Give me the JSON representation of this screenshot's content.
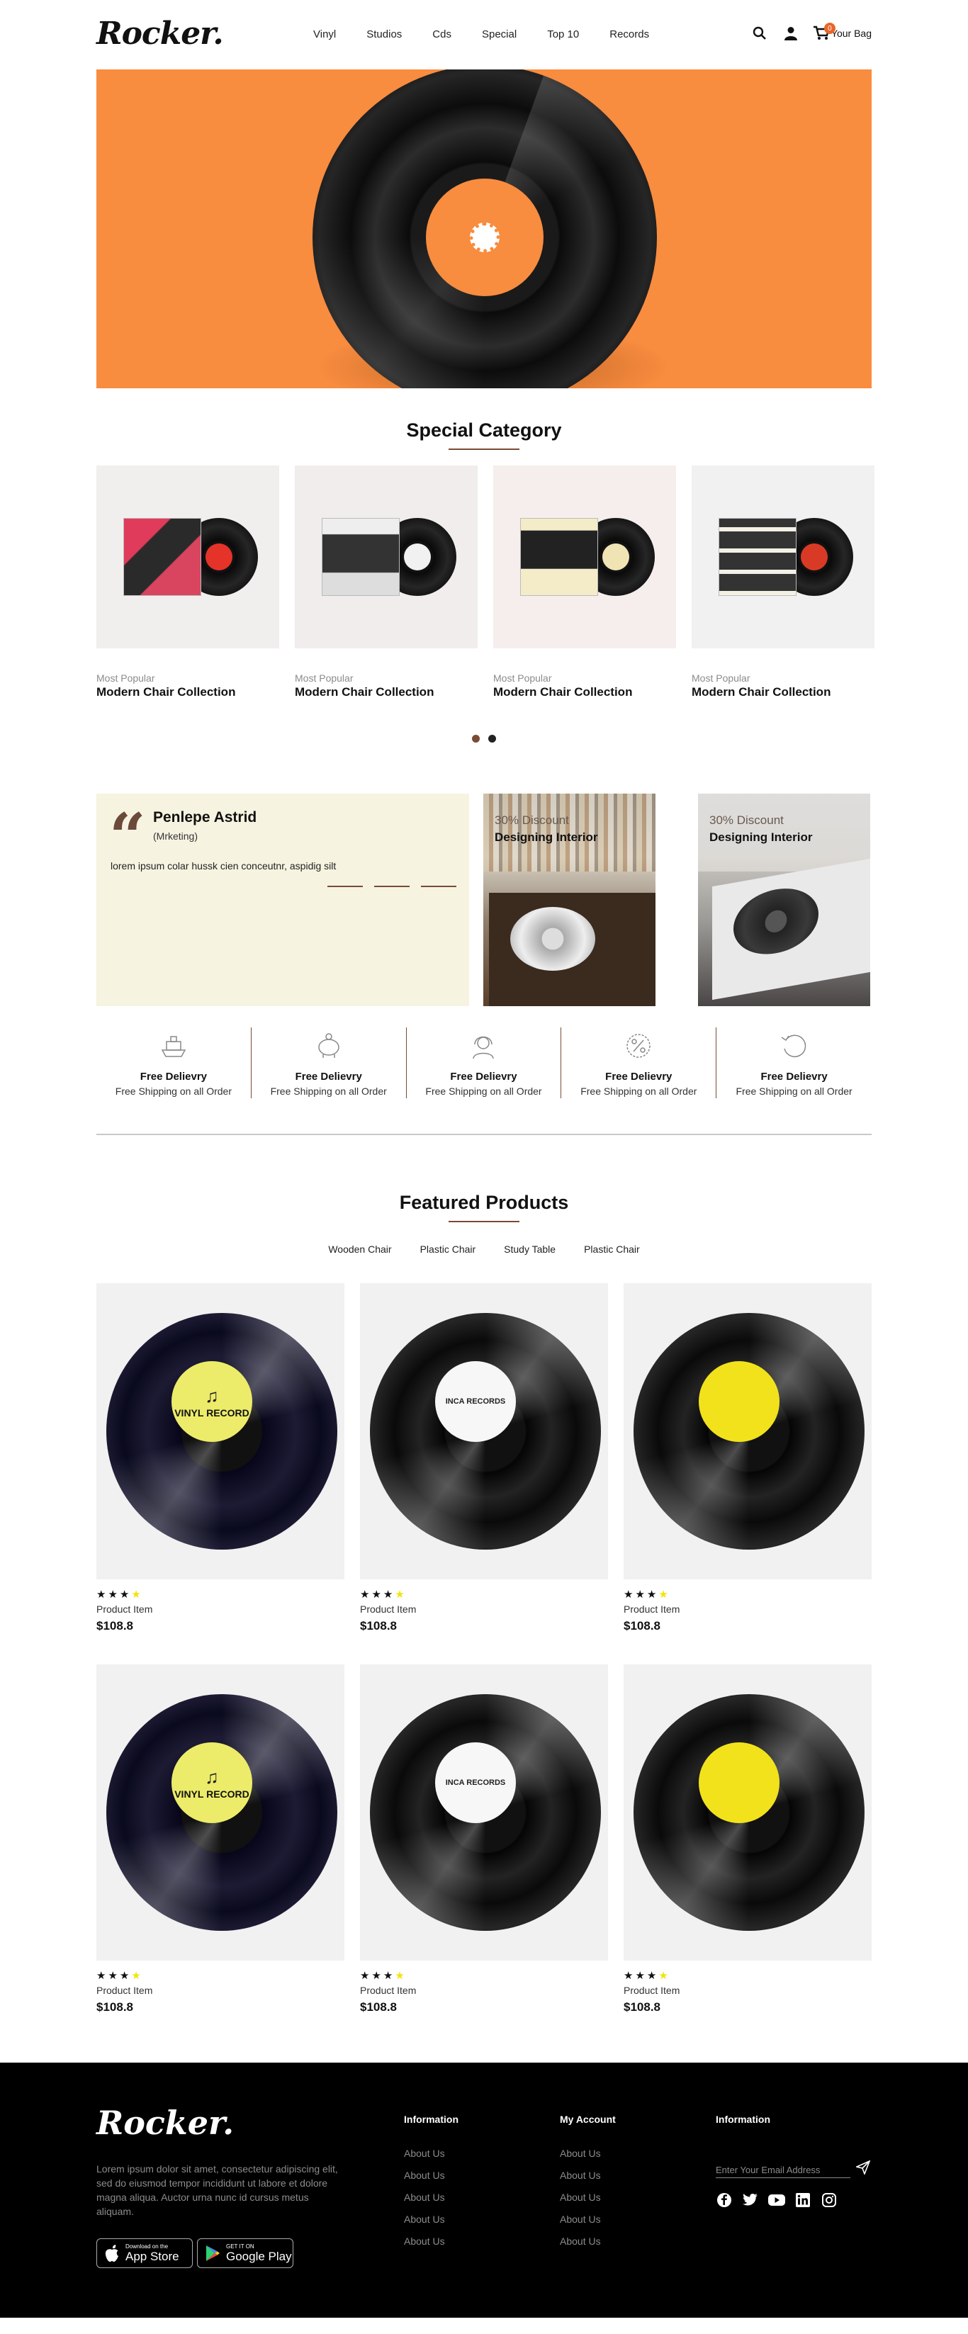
{
  "header": {
    "logo": "Rocker.",
    "nav": [
      "Vinyl",
      "Studios",
      "Cds",
      "Special",
      "Top 10",
      "Records"
    ],
    "bag_label": "Your Bag",
    "bag_count": "0",
    "icons": [
      "search-icon",
      "user-icon",
      "cart-icon"
    ]
  },
  "special": {
    "title": "Special Category",
    "items": [
      {
        "sub": "Most Popular",
        "name": "Modern Chair Collection"
      },
      {
        "sub": "Most Popular",
        "name": "Modern Chair Collection"
      },
      {
        "sub": "Most Popular",
        "name": "Modern Chair Collection"
      },
      {
        "sub": "Most Popular",
        "name": "Modern Chair Collection"
      }
    ]
  },
  "testimonial": {
    "name": "Penlepe Astrid",
    "role": "(Mrketing)",
    "text": "lorem ipsum colar hussk cien conceutnr, aspidig silt"
  },
  "promos": [
    {
      "discount": "30% Discount",
      "title": "Designing Interior"
    },
    {
      "discount": "30% Discount",
      "title": "Designing Interior"
    }
  ],
  "features": [
    {
      "icon": "ship-icon",
      "title": "Free Delievry",
      "sub": "Free Shipping on all Order"
    },
    {
      "icon": "piggy-bank-icon",
      "title": "Free Delievry",
      "sub": "Free Shipping on all Order"
    },
    {
      "icon": "support-headset-icon",
      "title": "Free Delievry",
      "sub": "Free Shipping on all Order"
    },
    {
      "icon": "percent-badge-icon",
      "title": "Free Delievry",
      "sub": "Free Shipping on all Order"
    },
    {
      "icon": "refresh-icon",
      "title": "Free Delievry",
      "sub": "Free Shipping on all Order"
    }
  ],
  "featured": {
    "title": "Featured Products",
    "tabs": [
      "Wooden Chair",
      "Plastic Chair",
      "Study Table",
      "Plastic Chair"
    ],
    "products": [
      {
        "name": "Product Item",
        "price": "$108.8",
        "rating": 3.5,
        "label": "VINYL RECORD"
      },
      {
        "name": "Product Item",
        "price": "$108.8",
        "rating": 3.5,
        "label": "INCA RECORDS"
      },
      {
        "name": "Product Item",
        "price": "$108.8",
        "rating": 3.5,
        "label": ""
      },
      {
        "name": "Product Item",
        "price": "$108.8",
        "rating": 3.5,
        "label": "VINYL RECORD"
      },
      {
        "name": "Product Item",
        "price": "$108.8",
        "rating": 3.5,
        "label": "INCA RECORDS"
      },
      {
        "name": "Product Item",
        "price": "$108.8",
        "rating": 3.5,
        "label": ""
      }
    ]
  },
  "footer": {
    "logo": "Rocker.",
    "about": "Lorem ipsum dolor sit amet, consectetur adipiscing elit, sed do eiusmod tempor incididunt ut labore et dolore magna aliqua. Auctor urna nunc id cursus metus aliquam.",
    "app_store_small": "Download on the",
    "app_store_big": "App Store",
    "play_small": "GET IT ON",
    "play_big": "Google Play",
    "col1": {
      "title": "Information",
      "links": [
        "About Us",
        "About Us",
        "About Us",
        "About Us",
        "About Us"
      ]
    },
    "col2": {
      "title": "My Account",
      "links": [
        "About Us",
        "About Us",
        "About Us",
        "About Us",
        "About Us"
      ]
    },
    "col3": {
      "title": "Information"
    },
    "email_placeholder": "Enter Your Email Address",
    "socials": [
      "facebook-icon",
      "twitter-icon",
      "youtube-icon",
      "linkedin-icon",
      "instagram-icon"
    ]
  },
  "colors": {
    "accent": "#f88c3f",
    "brown": "#7a4a34",
    "cream": "#f6f3e1",
    "star": "#f1e40c"
  }
}
